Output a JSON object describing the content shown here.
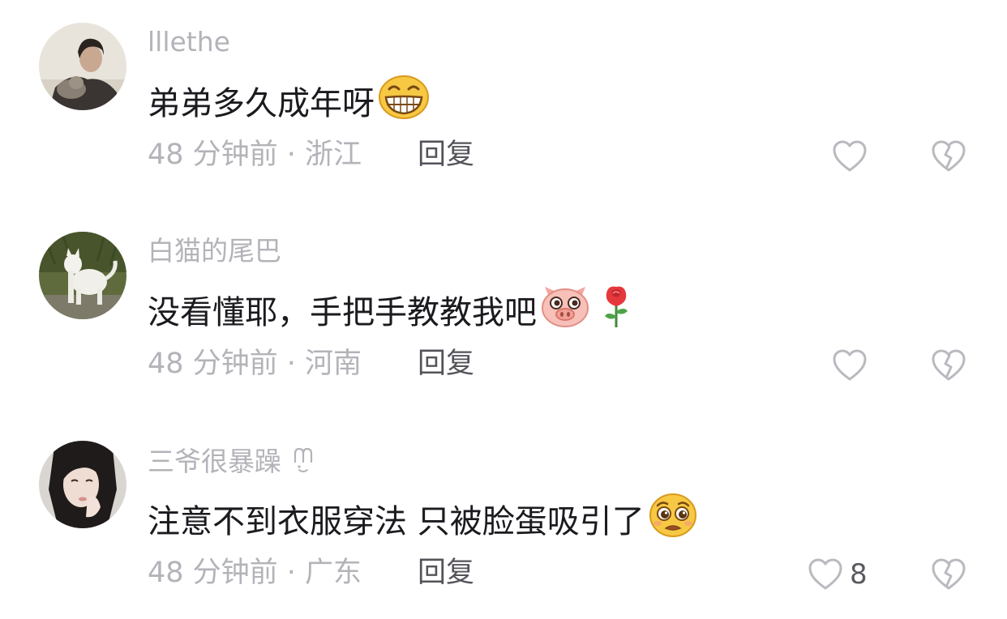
{
  "reply_label": "回复",
  "comments": [
    {
      "username": "lllethe",
      "text": "弟弟多久成年呀",
      "emojis": [
        "grin-emoji"
      ],
      "time": "48 分钟前",
      "location": "浙江",
      "meta": "48 分钟前 · 浙江",
      "likes": ""
    },
    {
      "username": "白猫的尾巴",
      "text": "没看懂耶，手把手教教我吧",
      "emojis": [
        "pig-emoji",
        "rose-emoji"
      ],
      "time": "48 分钟前",
      "location": "河南",
      "meta": "48 分钟前 · 河南",
      "likes": ""
    },
    {
      "username": "三爷很暴躁",
      "text": "注意不到衣服穿法 只被脸蛋吸引了",
      "emojis": [
        "pleading-emoji"
      ],
      "time": "48 分钟前",
      "location": "广东",
      "meta": "48 分钟前 · 广东",
      "likes": "8"
    }
  ],
  "colors": {
    "secondary_text": "#b3b3b9",
    "primary_text": "#1a1a1f",
    "reply_text": "#53535a",
    "icon_stroke": "#b9b9bf"
  }
}
